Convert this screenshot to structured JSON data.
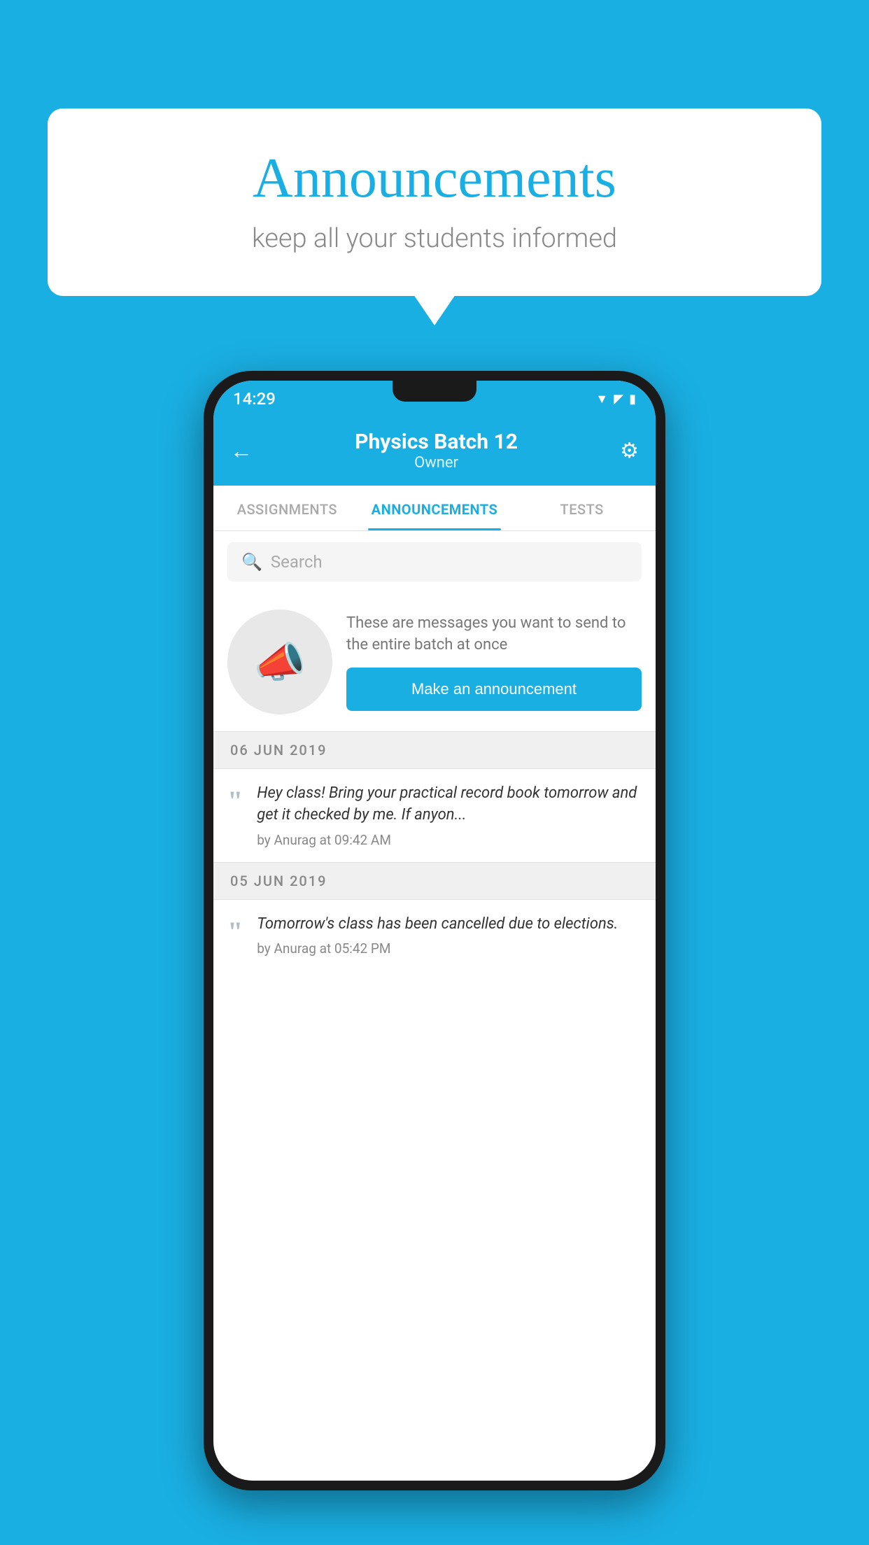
{
  "background": {
    "color": "#1AAFE3"
  },
  "bubble": {
    "title": "Announcements",
    "subtitle": "keep all your students informed"
  },
  "phone": {
    "status_bar": {
      "time": "14:29",
      "wifi_icon": "▲",
      "signal_icon": "▲",
      "battery_icon": "▮"
    },
    "header": {
      "back_label": "←",
      "title": "Physics Batch 12",
      "subtitle": "Owner",
      "gear_label": "⚙"
    },
    "tabs": [
      {
        "label": "ASSIGNMENTS",
        "active": false
      },
      {
        "label": "ANNOUNCEMENTS",
        "active": true
      },
      {
        "label": "TESTS",
        "active": false
      },
      {
        "label": "...",
        "active": false
      }
    ],
    "search": {
      "placeholder": "Search"
    },
    "promo": {
      "description": "These are messages you want to send to the entire batch at once",
      "button_label": "Make an announcement"
    },
    "announcements": [
      {
        "date": "06  JUN  2019",
        "text": "Hey class! Bring your practical record book tomorrow and get it checked by me. If anyon...",
        "meta": "by Anurag at 09:42 AM"
      },
      {
        "date": "05  JUN  2019",
        "text": "Tomorrow's class has been cancelled due to elections.",
        "meta": "by Anurag at 05:42 PM"
      }
    ]
  }
}
